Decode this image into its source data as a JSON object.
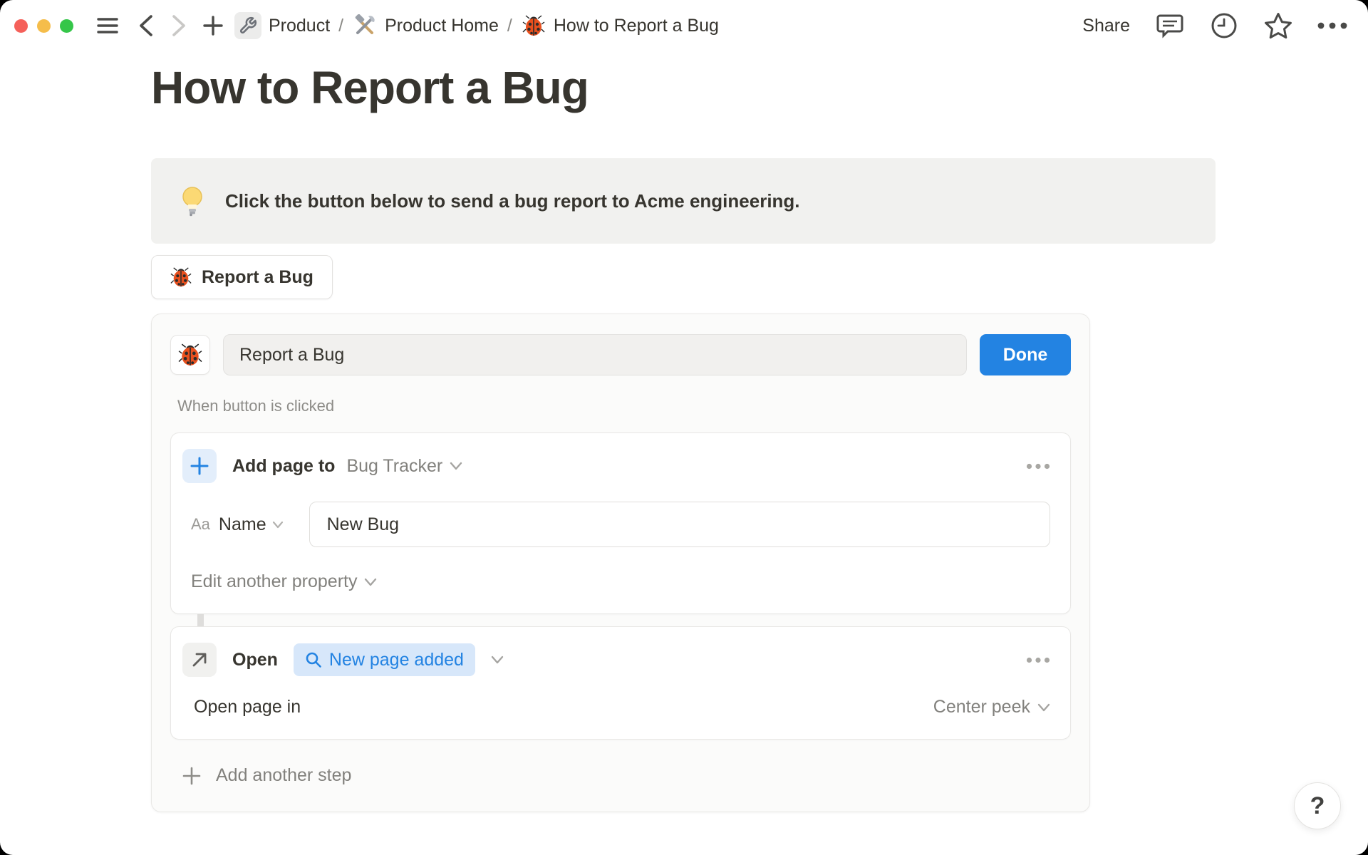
{
  "topbar": {
    "breadcrumb": [
      {
        "icon": "wrench-icon",
        "label": "Product"
      },
      {
        "icon": "hammer-wrench-icon",
        "label": "Product Home"
      },
      {
        "icon": "ladybug-icon",
        "label": "How to Report a Bug"
      }
    ],
    "separator": "/",
    "share_label": "Share"
  },
  "page": {
    "title": "How to Report a Bug",
    "callout": {
      "icon": "light-bulb-icon",
      "text": "Click the button below to send a bug report to Acme engineering."
    },
    "bug_button_label": "Report a Bug"
  },
  "panel": {
    "button_name_value": "Report a Bug",
    "done_label": "Done",
    "trigger_label": "When button is clicked",
    "step1": {
      "action_label": "Add page to",
      "target": "Bug Tracker",
      "property_type": "Aa",
      "property_name": "Name",
      "property_value": "New Bug",
      "edit_property_label": "Edit another property"
    },
    "step2": {
      "action_label": "Open",
      "target_pill": "New page added",
      "open_page_in_label": "Open page in",
      "open_mode": "Center peek"
    },
    "add_step_label": "Add another step"
  },
  "help_label": "?",
  "colors": {
    "accent_blue": "#2383e2",
    "text_dark": "#37352f",
    "text_gray": "#82817d",
    "callout_bg": "#f1f1ef",
    "panel_bg": "#fbfbfa",
    "pill_bg": "#d7e7fa"
  }
}
